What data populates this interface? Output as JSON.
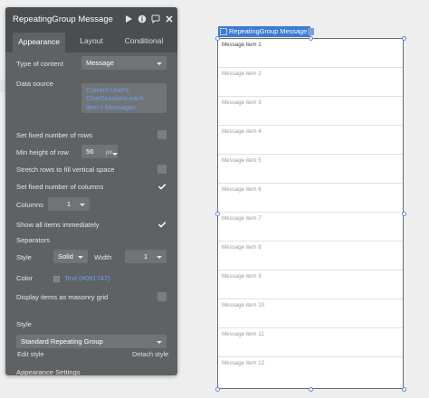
{
  "panel": {
    "title": "RepeatingGroup Message",
    "tabs": [
      {
        "label": "Appearance",
        "active": true
      },
      {
        "label": "Layout",
        "active": false
      },
      {
        "label": "Conditional",
        "active": false
      }
    ]
  },
  "fields": {
    "type_of_content_label": "Type of content",
    "type_of_content_value": "Message",
    "data_source_label": "Data source",
    "data_source_value": "Current User's ChatSessions:each item's Messages",
    "fixed_rows_label": "Set fixed number of rows",
    "fixed_rows_checked": false,
    "min_height_label": "Min height of row",
    "min_height_value": "56",
    "min_height_unit": "px",
    "stretch_label": "Stretch rows to fill vertical space",
    "stretch_checked": false,
    "fixed_columns_label": "Set fixed number of columns",
    "fixed_columns_checked": true,
    "columns_label": "Columns",
    "columns_value": "1",
    "show_all_label": "Show all items immediately",
    "show_all_checked": true,
    "separators_label": "Separators",
    "sep_style_label": "Style",
    "sep_style_value": "Solid",
    "sep_width_label": "Width",
    "sep_width_value": "1",
    "sep_color_label": "Color",
    "sep_color_value": "Text (#091747)",
    "masonry_label": "Display items as masonry grid",
    "masonry_checked": false,
    "style_label": "Style",
    "style_value": "Standard Repeating Group",
    "edit_style": "Edit style",
    "detach_style": "Detach style",
    "appearance_settings": "Appearance Settings"
  },
  "repeating_group": {
    "label": "RepeatingGroup Message",
    "items": [
      "Message item 1",
      "Message item 2",
      "Message item 3",
      "Message item 4",
      "Message item 5",
      "Message item 6",
      "Message item 7",
      "Message item 8",
      "Message item 9",
      "Message item 10",
      "Message item 11",
      "Message item 12"
    ]
  },
  "colors": {
    "link_blue": "#6fa0ea",
    "selection_blue": "#3c7bd6",
    "panel_bg": "#5e6264"
  },
  "icons": [
    "play-icon",
    "info-icon",
    "comment-icon",
    "close-icon",
    "checkmark-icon",
    "caret-down-icon",
    "group-icon"
  ]
}
